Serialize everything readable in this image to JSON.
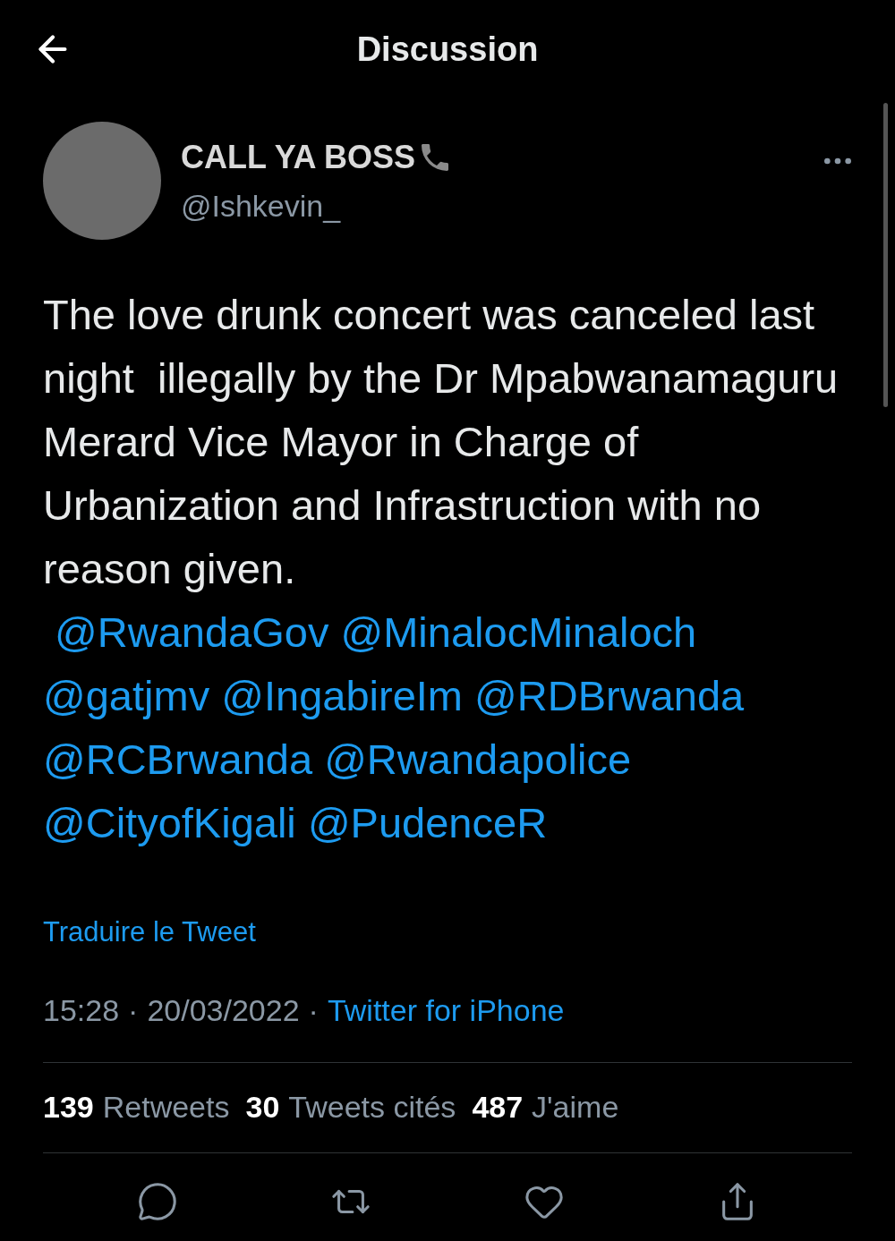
{
  "header": {
    "title": "Discussion"
  },
  "tweet": {
    "author": {
      "name": "CALL YA BOSS",
      "handle": "@Ishkevin_"
    },
    "text": "The love drunk concert was canceled last night  illegally by the Dr Mpabwanamaguru Merard Vice Mayor in Charge of Urbanization and Infrastruction with no reason given.",
    "mentions": [
      "@RwandaGov",
      "@MinalocMinaloch",
      "@gatjmv",
      "@IngabireIm",
      "@RDBrwanda",
      "@RCBrwanda",
      "@Rwandapolice",
      "@CityofKigali",
      "@PudenceR"
    ],
    "translate": "Traduire le Tweet",
    "time": "15:28",
    "separator": "·",
    "date": "20/03/2022",
    "source": "Twitter for iPhone",
    "stats": [
      {
        "count": "139",
        "label": "Retweets"
      },
      {
        "count": "30",
        "label": "Tweets cités"
      },
      {
        "count": "487",
        "label": "J'aime"
      }
    ],
    "actions": [
      {
        "kind": "reply"
      },
      {
        "kind": "retweet"
      },
      {
        "kind": "like"
      },
      {
        "kind": "share"
      }
    ]
  }
}
